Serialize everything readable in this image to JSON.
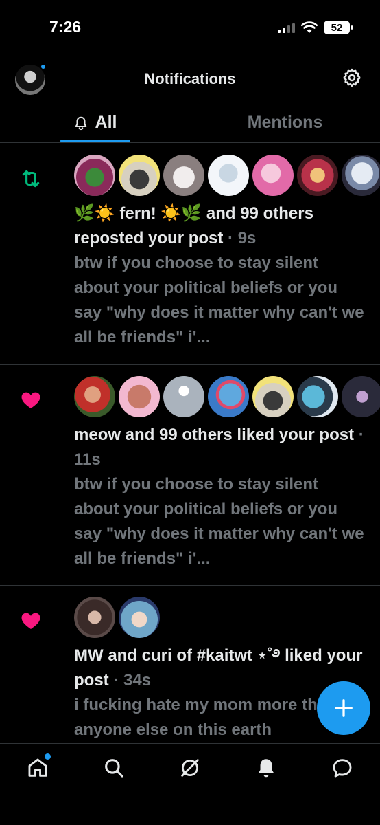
{
  "status_bar": {
    "time": "7:26",
    "battery": "52"
  },
  "header": {
    "title": "Notifications"
  },
  "tabs": [
    {
      "label": "All",
      "active": true
    },
    {
      "label": "Mentions",
      "active": false
    }
  ],
  "notifications": [
    {
      "type": "repost",
      "icon": "repost-icon",
      "avatar_colors": [
        "#8a2a5a",
        "#d7d0c0",
        "#c9bfbf",
        "#e8eef4",
        "#e26aa8",
        "#b8324a",
        "#c9d2e0"
      ],
      "title": "🌿☀️ fern! ☀️🌿 and 99 others reposted your post",
      "time": "· 9s",
      "body": "btw if you choose to stay silent about your political beliefs or you say \"why does it matter why can't we all be friends\" i'..."
    },
    {
      "type": "like",
      "icon": "heart-icon",
      "avatar_colors": [
        "#c0302a",
        "#c87a6a",
        "#aab3bd",
        "#5fa8de",
        "#d7d0c0",
        "#5bb8d8",
        "#2a2a3a"
      ],
      "title": "meow and 99 others liked your post",
      "time": "· 11s",
      "body": "btw if you choose to stay silent about your political beliefs or you say \"why does it matter why can't we all be friends\" i'..."
    },
    {
      "type": "like",
      "icon": "heart-icon",
      "avatar_colors": [
        "#3a2a28",
        "#6fa6c8"
      ],
      "title": "MW and curi of #kaitwt ⋆˚࿔ liked your post",
      "time": "· 34s",
      "body": "i fucking hate my mom more than anyone else on this earth"
    }
  ],
  "bottom_nav": [
    {
      "label": "home",
      "icon": "home-icon"
    },
    {
      "label": "search",
      "icon": "search-icon"
    },
    {
      "label": "grok",
      "icon": "grok-icon"
    },
    {
      "label": "notifications",
      "icon": "bell-icon"
    },
    {
      "label": "messages",
      "icon": "message-icon"
    }
  ],
  "colors": {
    "accent": "#1d9bf0",
    "repost": "#00ba7c",
    "like": "#f91880",
    "muted": "#71767b"
  }
}
